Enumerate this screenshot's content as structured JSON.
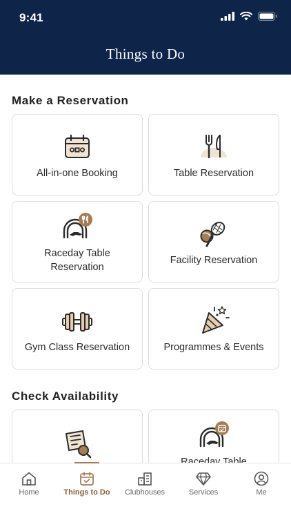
{
  "status": {
    "time": "9:41"
  },
  "header": {
    "title": "Things to Do"
  },
  "sections": {
    "reservation_title": "Make a Reservation",
    "availability_title": "Check Availability"
  },
  "reservations": [
    {
      "label": "All-in-one Booking",
      "icon": "calendar-booking-icon"
    },
    {
      "label": "Table Reservation",
      "icon": "fork-knife-icon"
    },
    {
      "label": "Raceday Table Reservation",
      "icon": "racecourse-dining-icon"
    },
    {
      "label": "Facility Reservation",
      "icon": "racket-ball-icon"
    },
    {
      "label": "Gym Class Reservation",
      "icon": "dumbbell-icon"
    },
    {
      "label": "Programmes & Events",
      "icon": "party-popper-icon"
    }
  ],
  "availability": [
    {
      "label": "",
      "icon": "document-search-icon"
    },
    {
      "label": "Raceday Table",
      "icon": "racecourse-calendar-icon"
    }
  ],
  "tabs": [
    {
      "label": "Home",
      "icon": "home-icon",
      "active": false
    },
    {
      "label": "Things to Do",
      "icon": "calendar-check-icon",
      "active": true
    },
    {
      "label": "Clubhouses",
      "icon": "building-icon",
      "active": false
    },
    {
      "label": "Services",
      "icon": "diamond-icon",
      "active": false
    },
    {
      "label": "Me",
      "icon": "user-icon",
      "active": false
    }
  ],
  "colors": {
    "header": "#0f2449",
    "accent": "#a57e55",
    "accent_light": "#f1e3d2"
  }
}
